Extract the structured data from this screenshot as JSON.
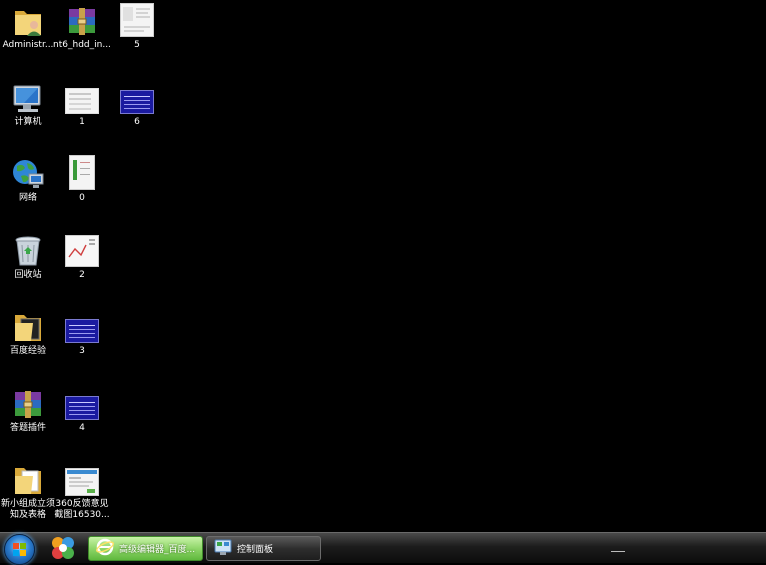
{
  "desktop": {
    "icons": [
      {
        "label": "Administr...",
        "icon": "user-folder-icon"
      },
      {
        "label": "nt6_hdd_in...",
        "icon": "winrar-archive-icon"
      },
      {
        "label": "5",
        "icon": "image-thumbnail-icon"
      },
      {
        "label": "计算机",
        "icon": "computer-icon"
      },
      {
        "label": "1",
        "icon": "image-thumbnail-icon"
      },
      {
        "label": "6",
        "icon": "image-thumbnail-icon"
      },
      {
        "label": "网络",
        "icon": "network-globe-icon"
      },
      {
        "label": "0",
        "icon": "image-thumbnail-icon"
      },
      {
        "label": "回收站",
        "icon": "recycle-bin-icon"
      },
      {
        "label": "2",
        "icon": "image-thumbnail-icon"
      },
      {
        "label": "百度经验",
        "icon": "folder-icon"
      },
      {
        "label": "3",
        "icon": "image-thumbnail-icon"
      },
      {
        "label": "答题插件",
        "icon": "winrar-archive-icon"
      },
      {
        "label": "4",
        "icon": "image-thumbnail-icon"
      },
      {
        "label": "新小组成立须知及表格",
        "icon": "folder-icon"
      },
      {
        "label": "360反馈意见截图16530...",
        "icon": "image-thumbnail-icon"
      }
    ]
  },
  "taskbar": {
    "start_icon": "windows-start-orb-icon",
    "pinned_icon": "baofeng-media-icon",
    "tasks": [
      {
        "label": "高级编辑器_百度...",
        "icon": "ie-browser-icon",
        "active": true
      },
      {
        "label": "控制面板",
        "icon": "control-panel-icon",
        "active": false
      }
    ]
  },
  "colors": {
    "desktop_bg": "#000000",
    "active_task": "#8fd66a",
    "folder": "#e8c55a"
  }
}
